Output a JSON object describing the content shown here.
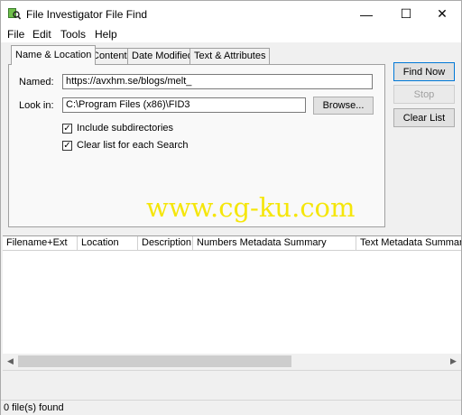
{
  "window": {
    "title": "File Investigator File Find",
    "minimize_glyph": "—",
    "maximize_glyph": "☐",
    "close_glyph": "✕",
    "icon": "app-magnifier-icon"
  },
  "menu": [
    "File",
    "Edit",
    "Tools",
    "Help"
  ],
  "tabs": [
    "Name & Location",
    "Content",
    "Date Modified",
    "Text & Attributes"
  ],
  "name_location": {
    "named_label": "Named:",
    "named_value": "https://avxhm.se/blogs/melt_",
    "lookin_label": "Look in:",
    "lookin_value": "C:\\Program Files (x86)\\FID3",
    "browse_label": "Browse...",
    "include_subdirs_label": "Include subdirectories",
    "include_subdirs_checked": true,
    "clear_list_label": "Clear list for each Search",
    "clear_list_checked": true
  },
  "actions": {
    "find_now": "Find Now",
    "stop": "Stop",
    "clear_list": "Clear List"
  },
  "watermark": "www.cg-ku.com",
  "columns": [
    "Filename+Ext",
    "Location",
    "Description",
    "Numbers Metadata Summary",
    "Text Metadata Summary"
  ],
  "status": "0 file(s) found"
}
